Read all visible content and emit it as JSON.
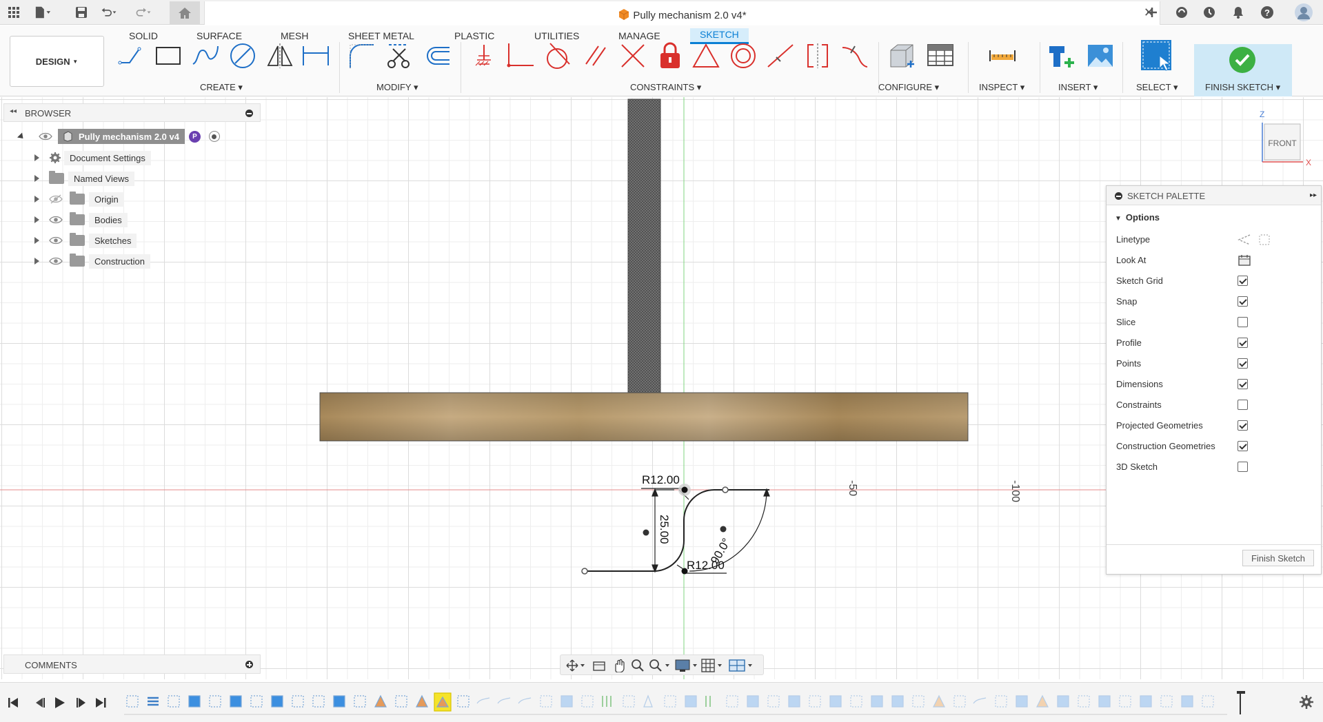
{
  "window": {
    "title": "Pully mechanism 2.0 v4*"
  },
  "titlebar": {
    "icons": [
      "apps-grid-icon",
      "file-icon",
      "save-icon",
      "undo-icon",
      "redo-icon",
      "home-icon"
    ],
    "right_icons": [
      "new-tab-icon",
      "extensions-icon",
      "job-status-icon",
      "notifications-icon",
      "help-icon",
      "profile-avatar"
    ]
  },
  "toolbar": {
    "workspace": "DESIGN",
    "tabs": [
      "SOLID",
      "SURFACE",
      "MESH",
      "SHEET METAL",
      "PLASTIC",
      "UTILITIES",
      "MANAGE",
      "SKETCH"
    ],
    "active_tab": "SKETCH",
    "groups": {
      "create": "CREATE",
      "modify": "MODIFY",
      "constraints": "CONSTRAINTS",
      "configure": "CONFIGURE",
      "inspect": "INSPECT",
      "insert": "INSERT",
      "select": "SELECT",
      "finish": "FINISH SKETCH"
    },
    "accent": "#0a7fd4",
    "constraint_color": "#d9302c"
  },
  "browser": {
    "title": "BROWSER",
    "root": "Pully mechanism 2.0 v4",
    "root_badge": "P",
    "items": [
      {
        "label": "Document Settings",
        "icon": "gear-icon"
      },
      {
        "label": "Named Views",
        "icon": "folder-icon"
      },
      {
        "label": "Origin",
        "icon": "folder-icon"
      },
      {
        "label": "Bodies",
        "icon": "folder-icon"
      },
      {
        "label": "Sketches",
        "icon": "folder-icon"
      },
      {
        "label": "Construction",
        "icon": "folder-icon"
      }
    ]
  },
  "comments": {
    "title": "COMMENTS"
  },
  "viewcube": {
    "face": "FRONT",
    "axis_z": "Z",
    "axis_x": "X"
  },
  "sketch": {
    "dim_r_top": "R12.00",
    "dim_height": "25.00",
    "dim_r_bottom": "R12.00",
    "dim_angle": "90.0°",
    "ruler_mark_1": "-50",
    "ruler_mark_2": "-100"
  },
  "palette": {
    "title": "SKETCH PALETTE",
    "section": "Options",
    "options": [
      {
        "label": "Linetype",
        "kind": "linetype"
      },
      {
        "label": "Look At",
        "kind": "lookat"
      },
      {
        "label": "Sketch Grid",
        "checked": true
      },
      {
        "label": "Snap",
        "checked": true
      },
      {
        "label": "Slice",
        "checked": false
      },
      {
        "label": "Profile",
        "checked": true
      },
      {
        "label": "Points",
        "checked": true
      },
      {
        "label": "Dimensions",
        "checked": true
      },
      {
        "label": "Constraints",
        "checked": false
      },
      {
        "label": "Projected Geometries",
        "checked": true
      },
      {
        "label": "Construction Geometries",
        "checked": true
      },
      {
        "label": "3D Sketch",
        "checked": false
      }
    ],
    "finish_button": "Finish Sketch"
  }
}
